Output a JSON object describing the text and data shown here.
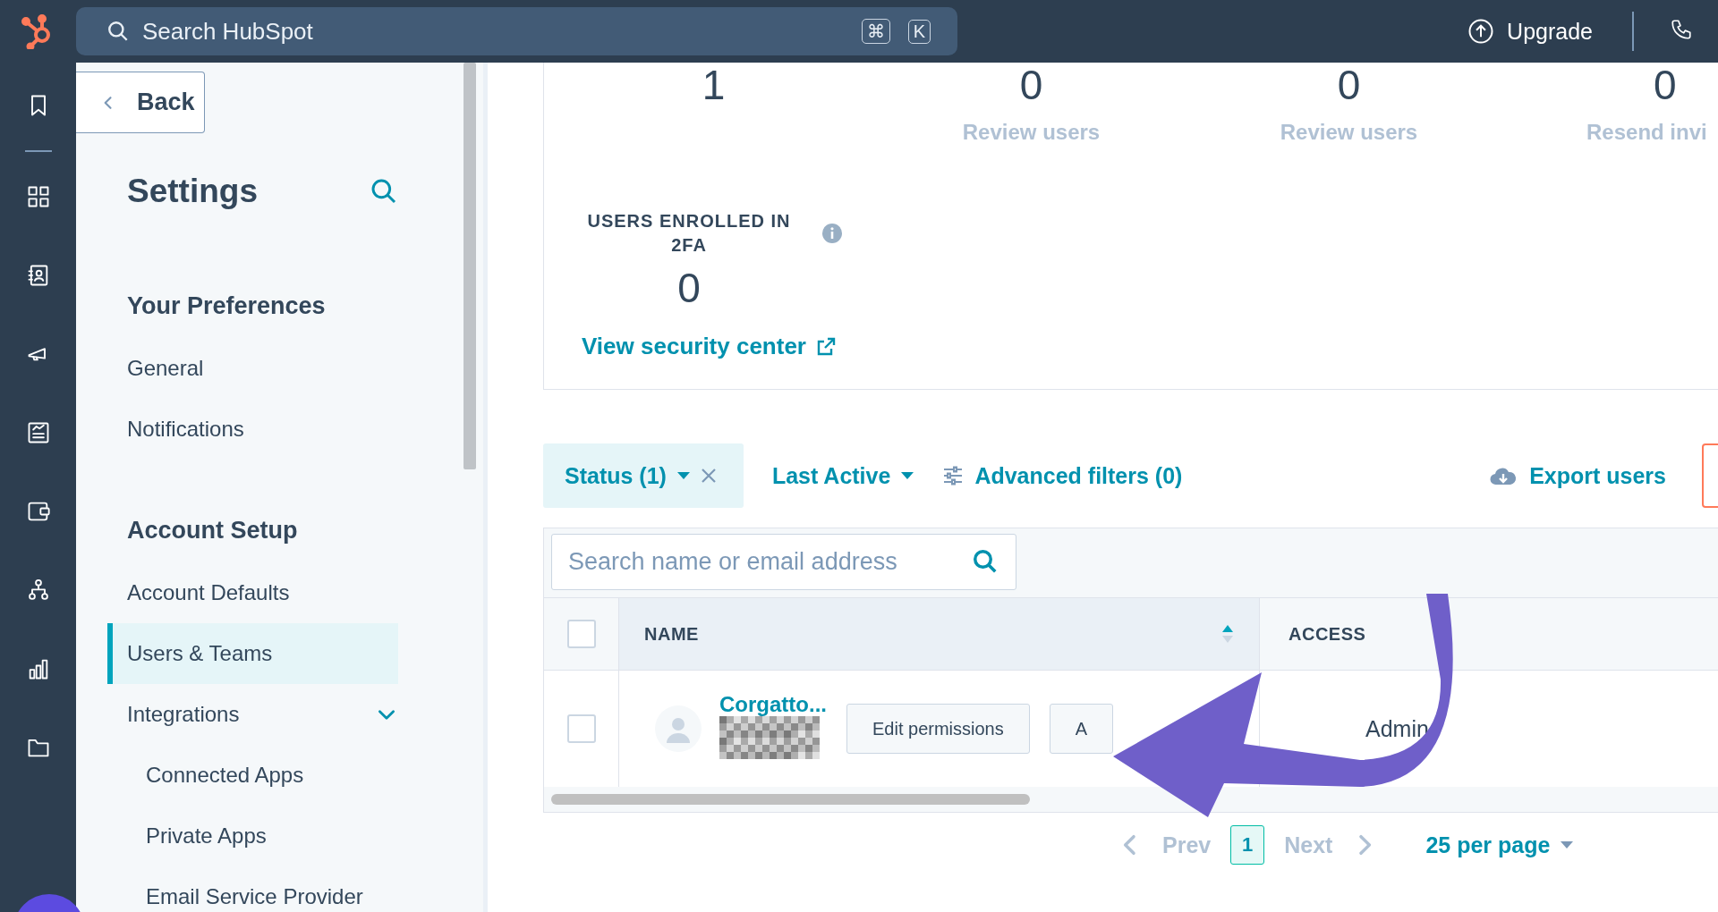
{
  "topbar": {
    "search_placeholder": "Search HubSpot",
    "shortcut_keys": [
      "⌘",
      "K"
    ],
    "upgrade": "Upgrade"
  },
  "settings": {
    "back": "Back",
    "title": "Settings",
    "sections": [
      {
        "heading": "Your Preferences",
        "items": [
          {
            "label": "General",
            "selected": false
          },
          {
            "label": "Notifications",
            "selected": false
          }
        ]
      },
      {
        "heading": "Account Setup",
        "items": [
          {
            "label": "Account Defaults",
            "selected": false
          },
          {
            "label": "Users & Teams",
            "selected": true
          },
          {
            "label": "Integrations",
            "selected": false,
            "expanded": true,
            "children": [
              {
                "label": "Connected Apps",
                "selected": false
              },
              {
                "label": "Private Apps",
                "selected": false
              },
              {
                "label": "Email Service Provider",
                "selected": false
              }
            ]
          }
        ]
      }
    ]
  },
  "stats": [
    {
      "value": "1"
    },
    {
      "value": "0",
      "label": "Review users"
    },
    {
      "value": "0",
      "label": "Review users"
    },
    {
      "value": "0",
      "label": "Resend invi"
    }
  ],
  "twofa": {
    "label": "USERS ENROLLED IN 2FA",
    "value": "0",
    "link": "View security center"
  },
  "filters": [
    {
      "kind": "chip",
      "label": "Status (1)"
    },
    {
      "kind": "dropdown",
      "label": "Last Active"
    },
    {
      "kind": "advanced",
      "label": "Advanced filters (0)"
    }
  ],
  "export": "Export users",
  "table": {
    "search_placeholder": "Search name or email address",
    "all_selected": false,
    "columns": [
      "NAME",
      "ACCESS"
    ],
    "rows": [
      {
        "selected": false,
        "name": "Corgatto...",
        "buttons": [
          "Edit permissions",
          "A"
        ],
        "access": "Admin"
      }
    ]
  },
  "pagination": {
    "prev": "Prev",
    "pages": [
      {
        "label": "1",
        "selected": true
      }
    ],
    "next": "Next",
    "per_page": "25 per page"
  }
}
